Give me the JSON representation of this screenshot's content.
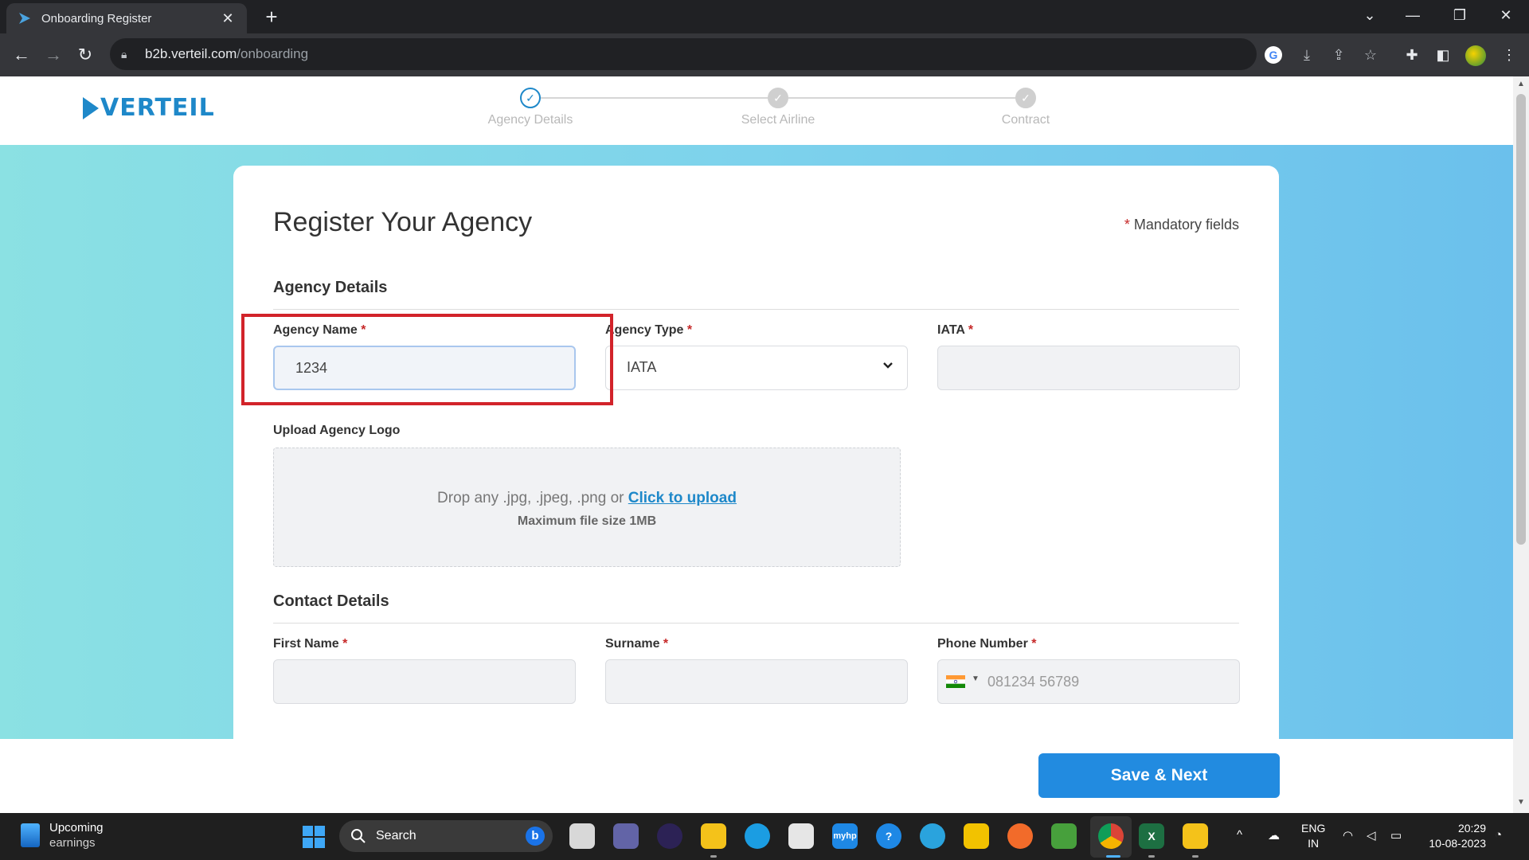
{
  "browser": {
    "tab_title": "Onboarding Register",
    "url_host": "b2b.verteil.com",
    "url_path": "/onboarding"
  },
  "brand": {
    "logo_text": "VERTEIL",
    "color": "#1e88c9"
  },
  "stepper": {
    "steps": [
      {
        "label": "Agency Details",
        "state": "active"
      },
      {
        "label": "Select Airline",
        "state": "pending"
      },
      {
        "label": "Contract",
        "state": "pending"
      }
    ]
  },
  "form": {
    "title": "Register Your Agency",
    "mandatory_star": "*",
    "mandatory_note": "Mandatory fields",
    "agency_section": "Agency Details",
    "agency_name": {
      "label": "Agency Name",
      "value": "1234"
    },
    "agency_type": {
      "label": "Agency Type",
      "value": "IATA"
    },
    "iata": {
      "label": "IATA",
      "value": ""
    },
    "upload": {
      "label": "Upload Agency Logo",
      "hint": "Drop any .jpg, .jpeg, .png or",
      "link": "Click to upload",
      "max_size": "Maximum file size 1MB"
    },
    "contact_section": "Contact Details",
    "first_name": {
      "label": "First Name",
      "value": ""
    },
    "surname": {
      "label": "Surname",
      "value": ""
    },
    "phone": {
      "label": "Phone Number",
      "placeholder": "081234 56789"
    },
    "save_label": "Save & Next"
  },
  "taskbar": {
    "weather_title": "Upcoming",
    "weather_sub": "earnings",
    "search_label": "Search",
    "lang_top": "ENG",
    "lang_bottom": "IN",
    "time": "20:29",
    "date": "10-08-2023"
  }
}
